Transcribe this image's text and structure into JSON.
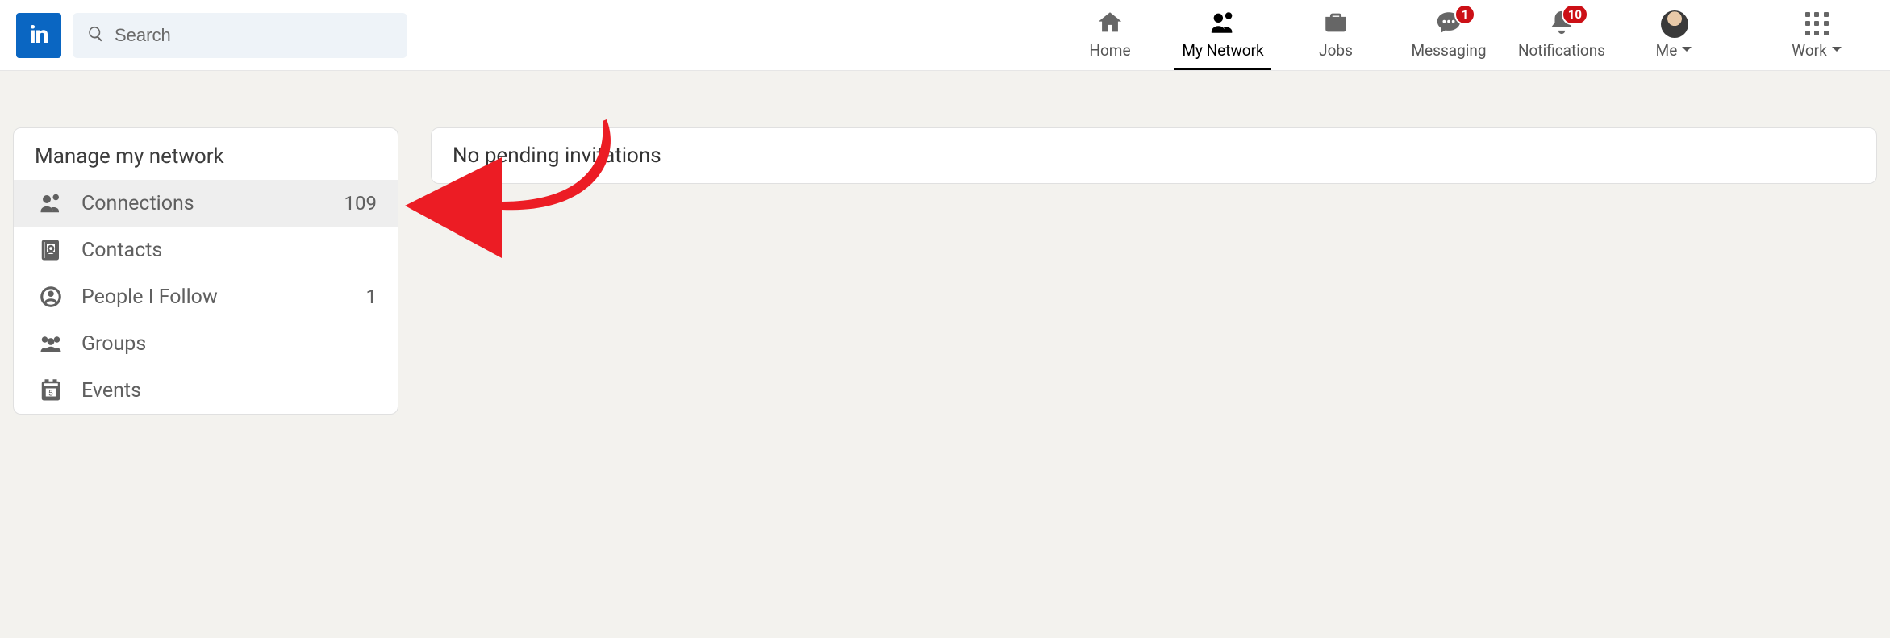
{
  "logo_text": "in",
  "search": {
    "placeholder": "Search"
  },
  "nav": {
    "home": "Home",
    "my_network": "My Network",
    "jobs": "Jobs",
    "messaging": "Messaging",
    "notifications": "Notifications",
    "me": "Me",
    "work": "Work",
    "messaging_badge": "1",
    "notifications_badge": "10"
  },
  "sidebar": {
    "title": "Manage my network",
    "items": [
      {
        "label": "Connections",
        "count": "109"
      },
      {
        "label": "Contacts",
        "count": ""
      },
      {
        "label": "People I Follow",
        "count": "1"
      },
      {
        "label": "Groups",
        "count": ""
      },
      {
        "label": "Events",
        "count": ""
      }
    ]
  },
  "main": {
    "pending_text": "No pending invitations"
  },
  "colors": {
    "brand": "#0a66c2",
    "badge": "#cc1016",
    "callout": "#ec1c24",
    "bg": "#f3f2ee"
  }
}
